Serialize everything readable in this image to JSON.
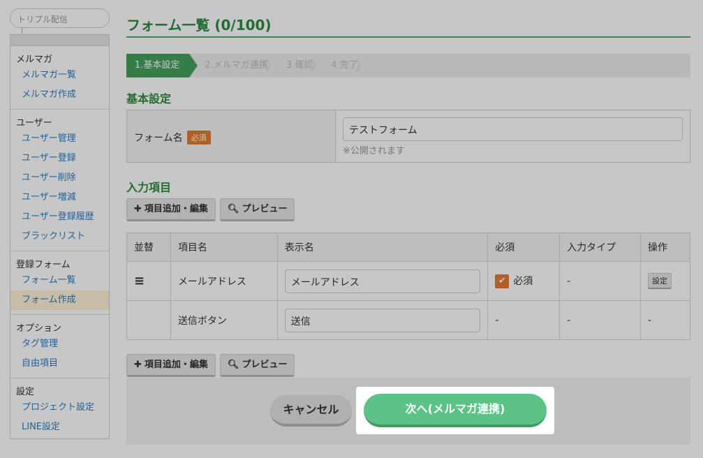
{
  "sidebar": {
    "search_placeholder": "トリプル配信",
    "groups": [
      {
        "heading": "メルマガ",
        "items": [
          "メルマガ一覧",
          "メルマガ作成"
        ]
      },
      {
        "heading": "ユーザー",
        "items": [
          "ユーザー管理",
          "ユーザー登録",
          "ユーザー削除",
          "ユーザー増減",
          "ユーザー登録履歴",
          "ブラックリスト"
        ]
      },
      {
        "heading": "登録フォーム",
        "items": [
          "フォーム一覧",
          "フォーム作成"
        ]
      },
      {
        "heading": "オプション",
        "items": [
          "タグ管理",
          "自由項目"
        ]
      },
      {
        "heading": "設定",
        "items": [
          "プロジェクト設定",
          "LINE設定"
        ]
      }
    ],
    "active_item": "フォーム作成"
  },
  "main": {
    "title": "フォーム一覧 (0/100)",
    "steps": [
      "1.基本設定",
      "2.メルマガ連携",
      "3.確認",
      "4.完了"
    ],
    "active_step": 0,
    "basic_section_title": "基本設定",
    "form_name_label": "フォーム名",
    "required_badge": "必須",
    "form_name_value": "テストフォーム",
    "form_name_note": "※公開されます",
    "input_section_title": "入力項目",
    "add_edit_button": "項目追加・編集",
    "preview_button": "プレビュー",
    "table": {
      "headers": [
        "並替",
        "項目名",
        "表示名",
        "必須",
        "入力タイプ",
        "操作"
      ],
      "rows": [
        {
          "sort_icon": "≡",
          "name": "メールアドレス",
          "display": "メールアドレス",
          "required_label": "必須",
          "input_type": "-",
          "action": "設定"
        },
        {
          "sort_icon": "",
          "name": "送信ボタン",
          "display": "送信",
          "required_label": "-",
          "input_type": "-",
          "action": "-"
        }
      ]
    },
    "cancel_button": "キャンセル",
    "next_button": "次へ(メルマガ連携)"
  },
  "colors": {
    "accent_green": "#43a05d",
    "title_green": "#2c8a3f",
    "next_button": "#5cc285",
    "required_orange": "#e27a34",
    "link_blue": "#2e7bbf"
  }
}
